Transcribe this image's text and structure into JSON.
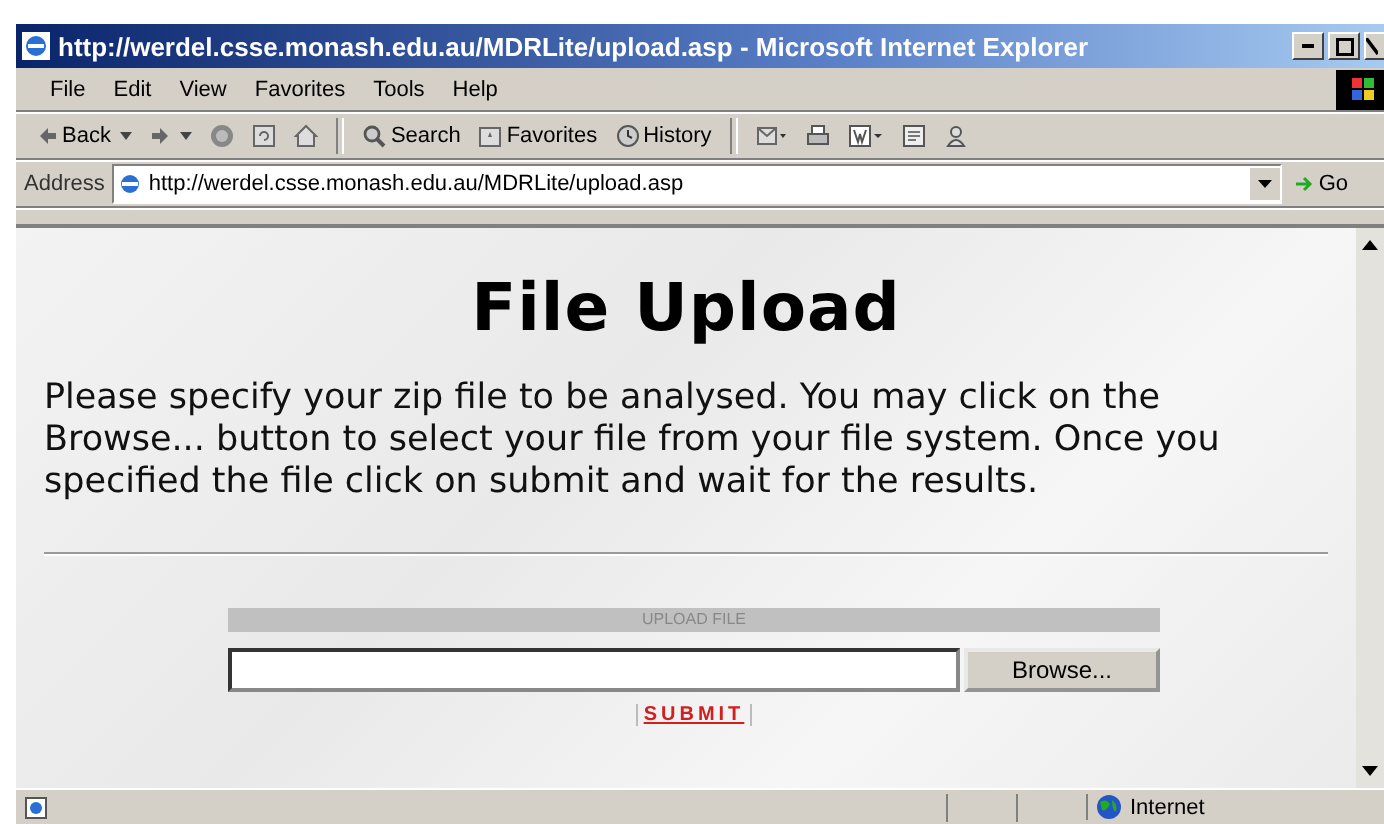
{
  "window": {
    "title": "http://werdel.csse.monash.edu.au/MDRLite/upload.asp - Microsoft Internet Explorer"
  },
  "menu": [
    "File",
    "Edit",
    "View",
    "Favorites",
    "Tools",
    "Help"
  ],
  "toolbar": [
    {
      "kind": "back",
      "label": "Back"
    },
    {
      "kind": "forward"
    },
    {
      "kind": "stop"
    },
    {
      "kind": "refresh"
    },
    {
      "kind": "home"
    },
    {
      "kind": "separator"
    },
    {
      "kind": "search",
      "label": "Search"
    },
    {
      "kind": "favorites",
      "label": "Favorites"
    },
    {
      "kind": "history",
      "label": "History"
    },
    {
      "kind": "separator"
    },
    {
      "kind": "mail"
    },
    {
      "kind": "print"
    },
    {
      "kind": "edit"
    },
    {
      "kind": "discuss"
    },
    {
      "kind": "messenger"
    }
  ],
  "address": {
    "label": "Address",
    "url": "http://werdel.csse.monash.edu.au/MDRLite/upload.asp",
    "go": "Go"
  },
  "page": {
    "heading": "File Upload",
    "paragraph": "Please specify your zip file to be analysed. You may click on the Browse... button to select your file from your file system. Once you specified the file click on submit and wait for the results.",
    "upload": {
      "header": "UPLOAD FILE",
      "browse": "Browse...",
      "submit": "SUBMIT"
    }
  },
  "status_bar": {
    "zone": "Internet"
  }
}
